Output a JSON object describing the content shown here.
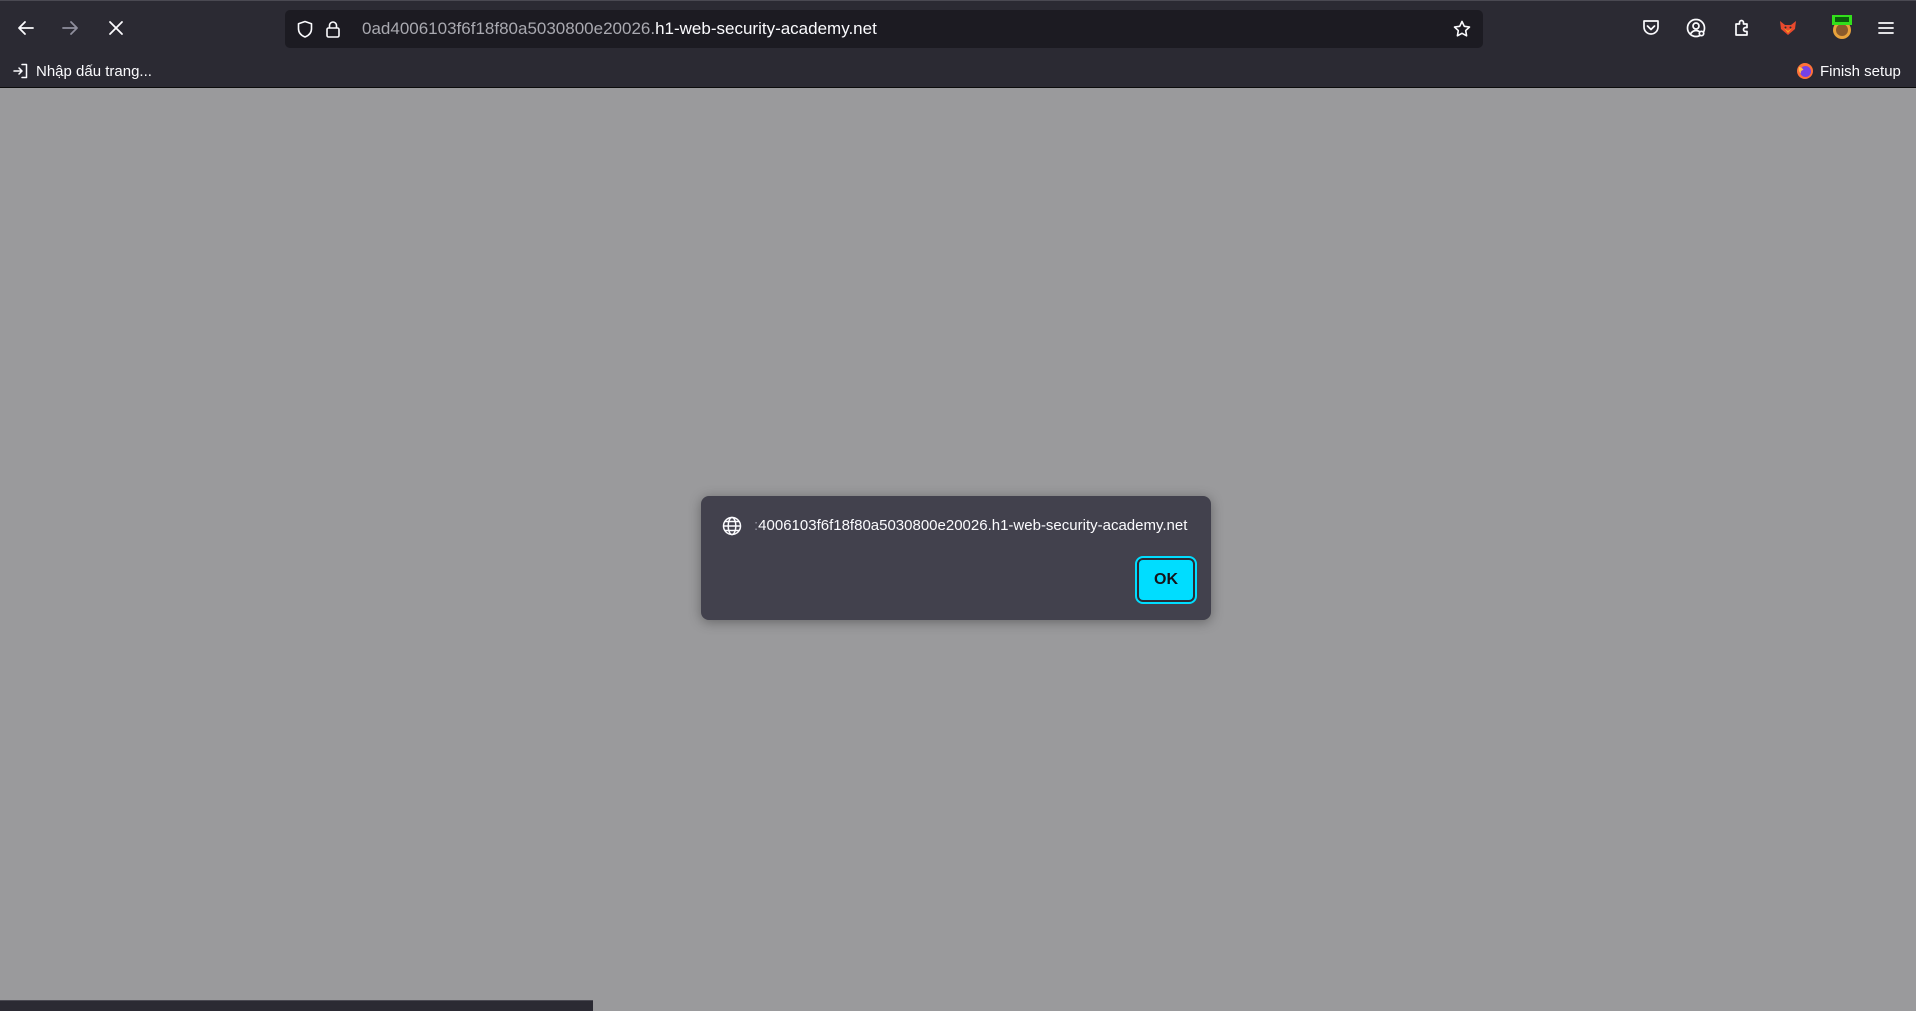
{
  "browser": {
    "url_prefix": "0ad4006103f6f18f80a5030800e20026.",
    "url_domain": "h1-web-security-academy.net"
  },
  "bookmarks": {
    "import_label": "Nhập dấu trang...",
    "finish_setup_label": "Finish setup"
  },
  "dialog": {
    "message_fade": ":",
    "message": "4006103f6f18f80a5030800e20026.h1-web-security-academy.net",
    "ok_label": "OK"
  },
  "colors": {
    "toolbar": "#2b2a33",
    "urlbar": "#1c1b22",
    "content": "#9a9a9c",
    "dialog": "#42414d",
    "accent": "#00ddff"
  },
  "icons": {
    "back": "back-arrow-icon",
    "forward": "forward-arrow-icon",
    "stop": "close-icon",
    "shield": "shield-icon",
    "lock": "lock-icon",
    "star": "star-icon",
    "pocket": "pocket-icon",
    "account": "account-icon",
    "extensions": "puzzle-icon",
    "fox_extension": "fox-extension-icon",
    "proxy_extension": "proxy-extension-icon",
    "menu": "hamburger-menu-icon",
    "import": "import-icon",
    "firefox": "firefox-icon",
    "globe": "globe-icon"
  }
}
